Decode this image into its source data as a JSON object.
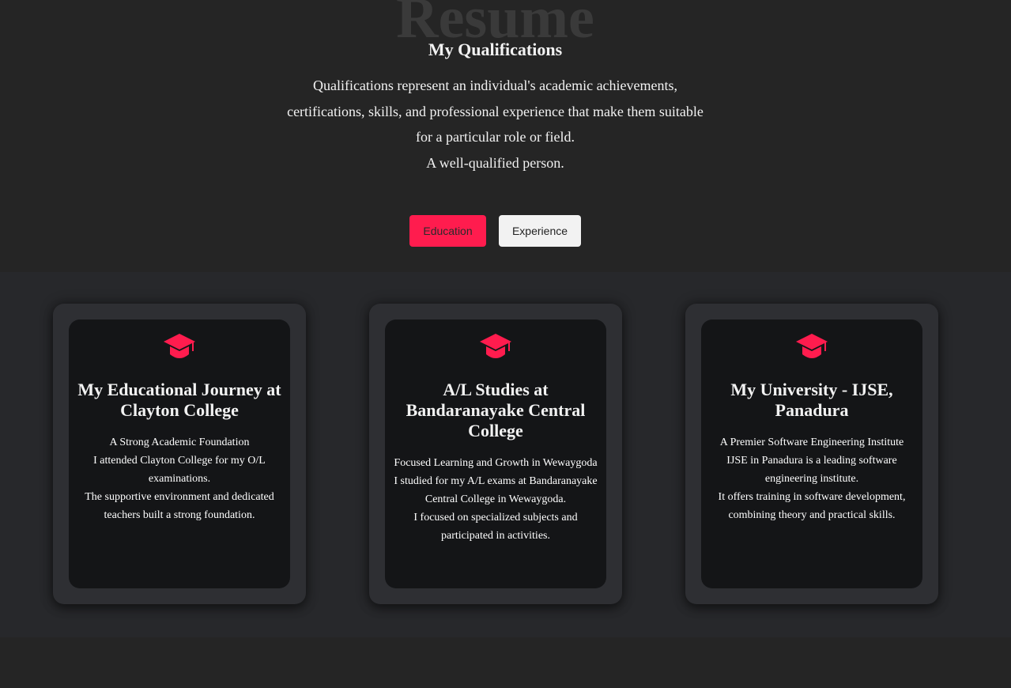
{
  "header": {
    "bg_word": "Resume",
    "subtitle": "My Qualifications",
    "description_lines": [
      "Qualifications represent an individual's academic achievements,",
      "certifications, skills, and professional experience that make them suitable",
      "for a particular role or field.",
      "A well-qualified person."
    ]
  },
  "tabs": {
    "education_label": "Education",
    "experience_label": "Experience",
    "active": "Education"
  },
  "colors": {
    "accent": "#ff1c4e",
    "background": "#252525",
    "card_inner": "#141517"
  },
  "cards": [
    {
      "icon": "graduation-cap-icon",
      "title": "My Educational Journey at Clayton College",
      "lines": [
        "A Strong Academic Foundation",
        "I attended Clayton College for my O/L examinations.",
        "The supportive environment and dedicated teachers built a strong foundation."
      ]
    },
    {
      "icon": "graduation-cap-icon",
      "title": "A/L Studies at Bandaranayake Central College",
      "lines": [
        "Focused Learning and Growth in Wewaygoda",
        "I studied for my A/L exams at Bandaranayake Central College in Wewaygoda.",
        "I focused on specialized subjects and participated in activities."
      ]
    },
    {
      "icon": "graduation-cap-icon",
      "title": "My University - IJSE, Panadura",
      "lines": [
        "A Premier Software Engineering Institute",
        "IJSE in Panadura is a leading software engineering institute.",
        "It offers training in software development, combining theory and practical skills."
      ]
    }
  ]
}
